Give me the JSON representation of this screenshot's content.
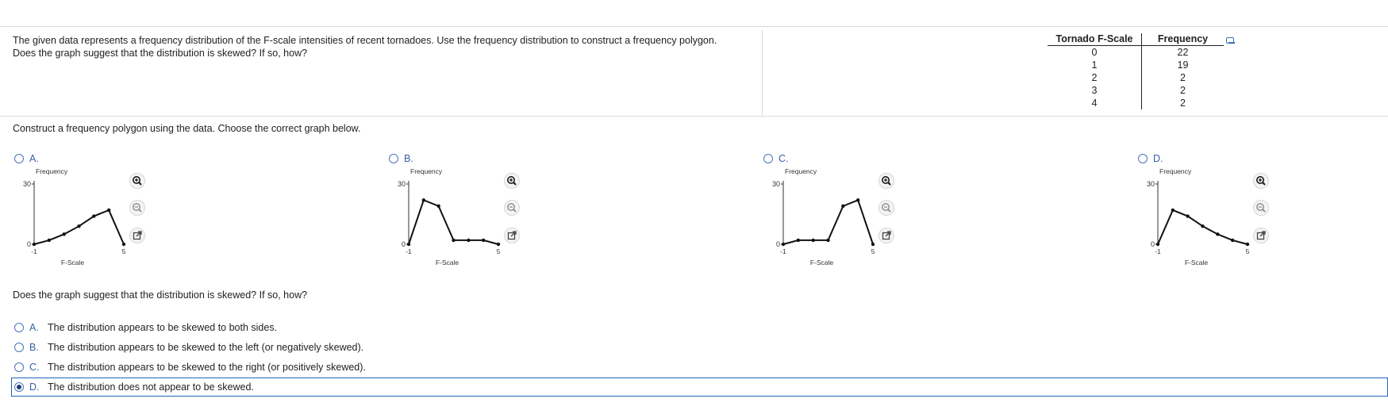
{
  "question": {
    "line1": "The given data represents a frequency distribution of the F-scale intensities of recent tornadoes. Use the frequency distribution to construct a frequency polygon.",
    "line2": "Does the graph suggest that the distribution is skewed? If so, how?"
  },
  "table": {
    "headers": [
      "Tornado F-Scale",
      "Frequency"
    ],
    "rows": [
      [
        "0",
        "22"
      ],
      [
        "1",
        "19"
      ],
      [
        "2",
        "2"
      ],
      [
        "3",
        "2"
      ],
      [
        "4",
        "2"
      ]
    ]
  },
  "instruction": "Construct a frequency polygon using the data. Choose the correct graph below.",
  "graph_choices": [
    {
      "letter": "A.",
      "xlabel": "F-Scale",
      "ylabel": "Frequency",
      "xmin_label": "-1",
      "xmax_label": "5",
      "ymin_label": "0",
      "ymax_label": "30",
      "points": [
        [
          -1,
          0
        ],
        [
          0,
          2
        ],
        [
          1,
          5
        ],
        [
          2,
          9
        ],
        [
          3,
          14
        ],
        [
          4,
          17
        ],
        [
          5,
          0
        ]
      ]
    },
    {
      "letter": "B.",
      "xlabel": "F-Scale",
      "ylabel": "Frequency",
      "xmin_label": "-1",
      "xmax_label": "5",
      "ymin_label": "0",
      "ymax_label": "30",
      "points": [
        [
          -1,
          0
        ],
        [
          0,
          22
        ],
        [
          1,
          19
        ],
        [
          2,
          2
        ],
        [
          3,
          2
        ],
        [
          4,
          2
        ],
        [
          5,
          0
        ]
      ]
    },
    {
      "letter": "C.",
      "xlabel": "F-Scale",
      "ylabel": "Frequency",
      "xmin_label": "-1",
      "xmax_label": "5",
      "ymin_label": "0",
      "ymax_label": "30",
      "points": [
        [
          -1,
          0
        ],
        [
          0,
          2
        ],
        [
          1,
          2
        ],
        [
          2,
          2
        ],
        [
          3,
          19
        ],
        [
          4,
          22
        ],
        [
          5,
          0
        ]
      ]
    },
    {
      "letter": "D.",
      "xlabel": "F-Scale",
      "ylabel": "Frequency",
      "xmin_label": "-1",
      "xmax_label": "5",
      "ymin_label": "0",
      "ymax_label": "30",
      "points": [
        [
          -1,
          0
        ],
        [
          0,
          17
        ],
        [
          1,
          14
        ],
        [
          2,
          9
        ],
        [
          3,
          5
        ],
        [
          4,
          2
        ],
        [
          5,
          0
        ]
      ]
    }
  ],
  "tools": [
    "zoom-in-icon",
    "zoom-out-icon",
    "open-new-window-icon"
  ],
  "skew_question": "Does the graph suggest that the distribution is skewed? If so, how?",
  "skew_options": [
    {
      "letter": "A.",
      "text": "The distribution appears to be skewed to both sides.",
      "selected": false
    },
    {
      "letter": "B.",
      "text": "The distribution appears to be skewed to the left (or negatively skewed).",
      "selected": false
    },
    {
      "letter": "C.",
      "text": "The distribution appears to be skewed to the right (or positively skewed).",
      "selected": false
    },
    {
      "letter": "D.",
      "text": "The distribution does not appear to be skewed.",
      "selected": true
    }
  ],
  "colors": {
    "accent": "#1f66b5",
    "radio": "#4a74b8",
    "letter": "#3a5fa8"
  }
}
